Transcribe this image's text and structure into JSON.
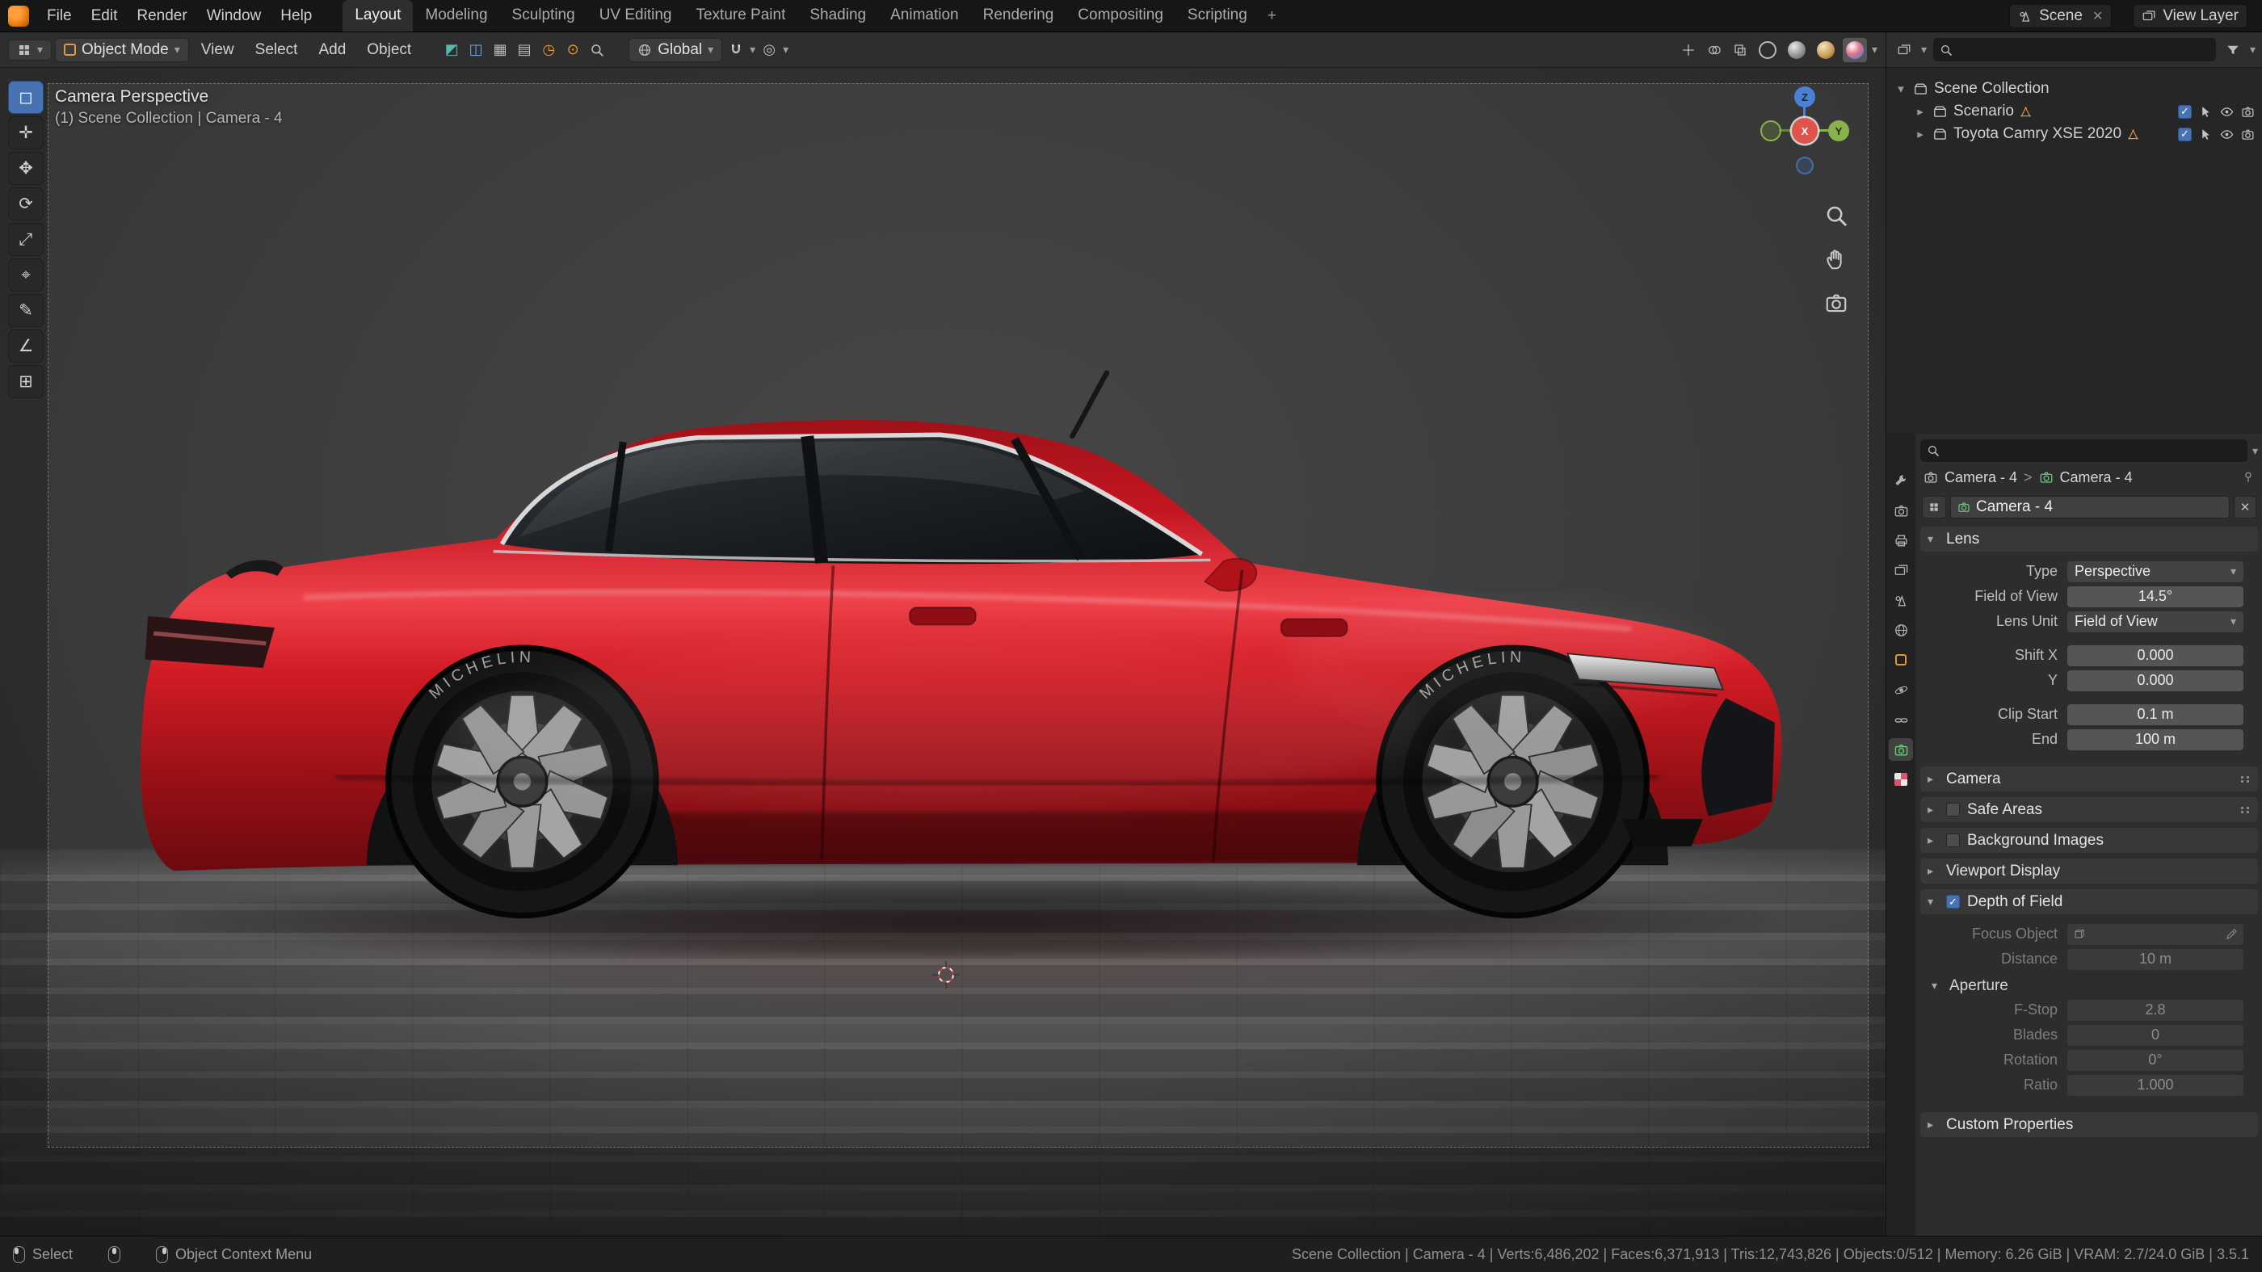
{
  "colors": {
    "accent": "#4772B3",
    "axis_x": "#E0534A",
    "axis_y": "#8AB24A",
    "axis_z": "#4A80D6"
  },
  "icons": {
    "dropdown": "▾",
    "caret_right": "▸",
    "caret_down": "▾",
    "check": "✓",
    "close": "✕",
    "sep": ">"
  },
  "topbar": {
    "menus": [
      "File",
      "Edit",
      "Render",
      "Window",
      "Help"
    ],
    "workspaces": [
      "Layout",
      "Modeling",
      "Sculpting",
      "UV Editing",
      "Texture Paint",
      "Shading",
      "Animation",
      "Rendering",
      "Compositing",
      "Scripting"
    ],
    "add_tab": "+",
    "scene_label": "Scene",
    "view_layer_label": "View Layer"
  },
  "vph": {
    "mode": "Object Mode",
    "menus": [
      "View",
      "Select",
      "Add",
      "Object"
    ],
    "orientation": "Global",
    "cluster": [
      "◩",
      "◫",
      "▦",
      "▤",
      "◷",
      "⊙"
    ],
    "prop_edit": "◎"
  },
  "viewport": {
    "title": "Camera Perspective",
    "subtitle": "(1) Scene Collection | Camera - 4"
  },
  "toolbar": {
    "tools": [
      {
        "name": "select-box",
        "glyph": "◻"
      },
      {
        "name": "cursor",
        "glyph": "✛"
      },
      {
        "name": "move",
        "glyph": "✥"
      },
      {
        "name": "rotate",
        "glyph": "⟳"
      },
      {
        "name": "scale",
        "glyph": "⤢"
      },
      {
        "name": "transform",
        "glyph": "⌖"
      },
      {
        "name": "annotate",
        "glyph": "✎"
      },
      {
        "name": "measure",
        "glyph": "∠"
      },
      {
        "name": "add-cube",
        "glyph": "⊞"
      }
    ]
  },
  "gizmo": {
    "x": "X",
    "y": "Y",
    "z": "Z"
  },
  "car": {
    "tire_brand": "MICHELIN",
    "paint": "#C5161D"
  },
  "outliner": {
    "rows": [
      {
        "label": "Scene Collection"
      },
      {
        "label": "Scenario"
      },
      {
        "label": "Toyota Camry XSE 2020"
      }
    ]
  },
  "props": {
    "breadcrumb": {
      "object": "Camera - 4",
      "data": "Camera - 4"
    },
    "datablock_name": "Camera - 4",
    "lens": {
      "title": "Lens",
      "type_label": "Type",
      "type_value": "Perspective",
      "fov_label": "Field of View",
      "fov_value": "14.5°",
      "unit_label": "Lens Unit",
      "unit_value": "Field of View",
      "shiftx_label": "Shift X",
      "shiftx_value": "0.000",
      "shifty_label": "Y",
      "shifty_value": "0.000",
      "clipstart_label": "Clip Start",
      "clipstart_value": "0.1 m",
      "clipend_label": "End",
      "clipend_value": "100 m"
    },
    "panels": {
      "camera": "Camera",
      "safe_areas": "Safe Areas",
      "background_images": "Background Images",
      "viewport_display": "Viewport Display",
      "custom_properties": "Custom Properties"
    },
    "dof": {
      "title": "Depth of Field",
      "focus_label": "Focus Object",
      "distance_label": "Distance",
      "distance_value": "10 m",
      "aperture_title": "Aperture",
      "fstop_label": "F-Stop",
      "fstop_value": "2.8",
      "blades_label": "Blades",
      "blades_value": "0",
      "rotation_label": "Rotation",
      "rotation_value": "0°",
      "ratio_label": "Ratio",
      "ratio_value": "1.000"
    }
  },
  "statusbar": {
    "select_label": "Select",
    "context_label": "Object Context Menu",
    "stats": "Scene Collection | Camera - 4 | Verts:6,486,202 | Faces:6,371,913 | Tris:12,743,826 | Objects:0/512 | Memory: 6.26 GiB | VRAM: 2.7/24.0 GiB | 3.5.1"
  }
}
